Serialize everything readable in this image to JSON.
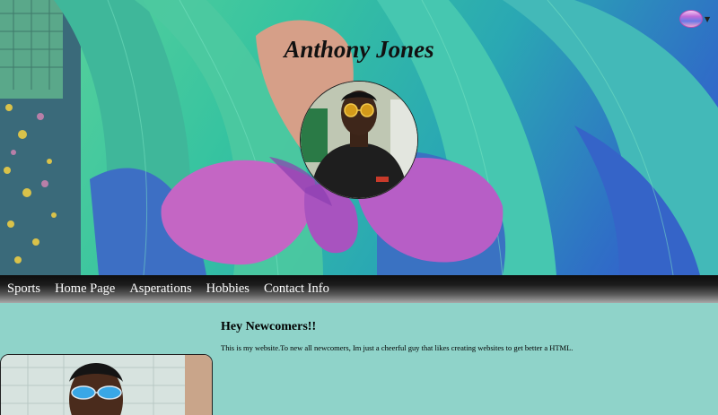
{
  "header": {
    "title": "Anthony Jones",
    "theme_toggle_icon": "theme-swatch-icon",
    "caret_icon": "chevron-down-icon"
  },
  "nav": {
    "items": [
      {
        "label": "Sports"
      },
      {
        "label": "Home Page"
      },
      {
        "label": "Asperations"
      },
      {
        "label": "Hobbies"
      },
      {
        "label": "Contact Info"
      }
    ]
  },
  "main": {
    "heading": "Hey Newcomers!!",
    "intro": "This is my website.To new all newcomers, Im just a cheerful guy that likes creating websites to get better a HTML."
  },
  "colors": {
    "content_bg": "#8fd3c9",
    "nav_top": "#0e0e0e",
    "nav_bottom": "#a8a8a8",
    "nav_text": "#ffffff"
  }
}
